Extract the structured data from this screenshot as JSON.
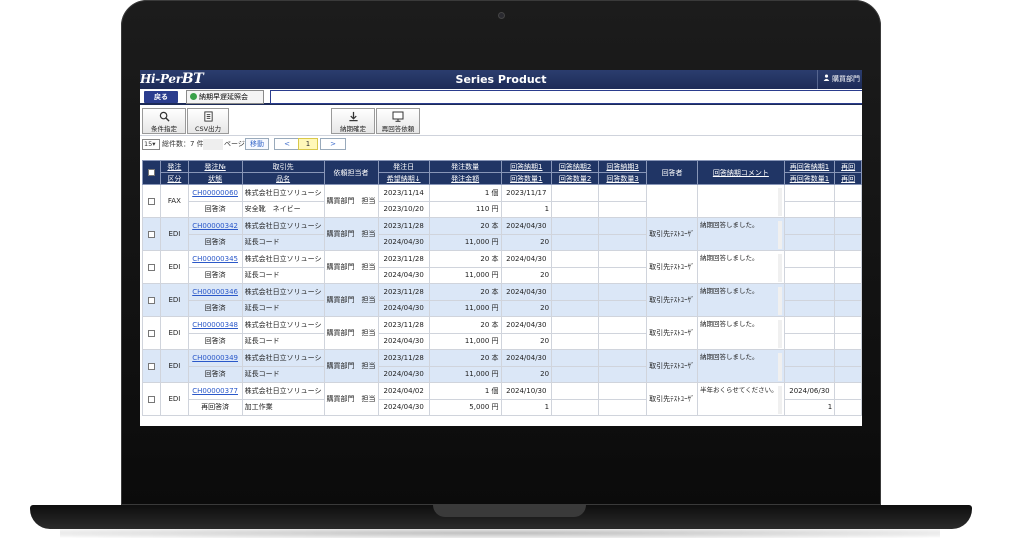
{
  "app": {
    "logo_main": "Hi-Per",
    "logo_suffix": "BT",
    "title": "Series Product",
    "user_label": "購買部門"
  },
  "nav": {
    "back_label": "戻る",
    "tab_label": "納期早遅延照会"
  },
  "toolbar": {
    "search_label": "条件指定",
    "csv_label": "CSV出力",
    "confirm_label": "納期確定",
    "reanswer_label": "再回答依頼"
  },
  "pager": {
    "per_page": "15",
    "count_text": "総件数：7 件",
    "page_label": "ページ",
    "move_label": "移動",
    "prev_label": "<",
    "current_page": "1",
    "next_label": ">"
  },
  "table": {
    "headers_top": [
      "",
      "発注",
      "発注№",
      "取引先",
      "依頼担当者",
      "発注日",
      "発注数量",
      "回答納期1",
      "回答納期2",
      "回答納期3",
      "回答者",
      "回答納期コメント",
      "再回答納期1",
      "再回"
    ],
    "headers_bottom": [
      "",
      "区分",
      "状態",
      "品名",
      "",
      "希望納期↓",
      "発注金額",
      "回答数量1",
      "回答数量2",
      "回答数量3",
      "",
      "",
      "再回答数量1",
      "再回"
    ],
    "rows": [
      {
        "kubun": "FAX",
        "no": "CH00000060",
        "status": "回答済",
        "vendor": "株式会社日立ソリューシ",
        "item": "安全靴　ネイビー",
        "requester": "購買部門　担当",
        "order_date": "2023/11/14",
        "desired": "2023/10/20",
        "qty": "1 個",
        "amount": "110 円",
        "ans_date1": "2023/11/17",
        "ans_qty1": "1",
        "answerer": "",
        "comment": "",
        "re_date1": "",
        "re_qty1": ""
      },
      {
        "kubun": "EDI",
        "no": "CH00000342",
        "status": "回答済",
        "vendor": "株式会社日立ソリューシ",
        "item": "延長コード",
        "requester": "購買部門　担当",
        "order_date": "2023/11/28",
        "desired": "2024/04/30",
        "qty": "20 本",
        "amount": "11,000 円",
        "ans_date1": "2024/04/30",
        "ans_qty1": "20",
        "answerer": "取引先ﾃｽﾄﾕｰｻﾞ",
        "comment": "納期回答しました。",
        "re_date1": "",
        "re_qty1": ""
      },
      {
        "kubun": "EDI",
        "no": "CH00000345",
        "status": "回答済",
        "vendor": "株式会社日立ソリューシ",
        "item": "延長コード",
        "requester": "購買部門　担当",
        "order_date": "2023/11/28",
        "desired": "2024/04/30",
        "qty": "20 本",
        "amount": "11,000 円",
        "ans_date1": "2024/04/30",
        "ans_qty1": "20",
        "answerer": "取引先ﾃｽﾄﾕｰｻﾞ",
        "comment": "納期回答しました。",
        "re_date1": "",
        "re_qty1": ""
      },
      {
        "kubun": "EDI",
        "no": "CH00000346",
        "status": "回答済",
        "vendor": "株式会社日立ソリューシ",
        "item": "延長コード",
        "requester": "購買部門　担当",
        "order_date": "2023/11/28",
        "desired": "2024/04/30",
        "qty": "20 本",
        "amount": "11,000 円",
        "ans_date1": "2024/04/30",
        "ans_qty1": "20",
        "answerer": "取引先ﾃｽﾄﾕｰｻﾞ",
        "comment": "納期回答しました。",
        "re_date1": "",
        "re_qty1": ""
      },
      {
        "kubun": "EDI",
        "no": "CH00000348",
        "status": "回答済",
        "vendor": "株式会社日立ソリューシ",
        "item": "延長コード",
        "requester": "購買部門　担当",
        "order_date": "2023/11/28",
        "desired": "2024/04/30",
        "qty": "20 本",
        "amount": "11,000 円",
        "ans_date1": "2024/04/30",
        "ans_qty1": "20",
        "answerer": "取引先ﾃｽﾄﾕｰｻﾞ",
        "comment": "納期回答しました。",
        "re_date1": "",
        "re_qty1": ""
      },
      {
        "kubun": "EDI",
        "no": "CH00000349",
        "status": "回答済",
        "vendor": "株式会社日立ソリューシ",
        "item": "延長コード",
        "requester": "購買部門　担当",
        "order_date": "2023/11/28",
        "desired": "2024/04/30",
        "qty": "20 本",
        "amount": "11,000 円",
        "ans_date1": "2024/04/30",
        "ans_qty1": "20",
        "answerer": "取引先ﾃｽﾄﾕｰｻﾞ",
        "comment": "納期回答しました。",
        "re_date1": "",
        "re_qty1": ""
      },
      {
        "kubun": "EDI",
        "no": "CH00000377",
        "status": "再回答済",
        "vendor": "株式会社日立ソリューシ",
        "item": "加工作業",
        "requester": "購買部門　担当",
        "order_date": "2024/04/02",
        "desired": "2024/04/30",
        "qty": "1 個",
        "amount": "5,000 円",
        "ans_date1": "2024/10/30",
        "ans_qty1": "1",
        "answerer": "取引先ﾃｽﾄﾕｰｻﾞ",
        "comment": "半年おくらせてください。",
        "re_date1": "2024/06/30",
        "re_qty1": "1"
      }
    ]
  }
}
